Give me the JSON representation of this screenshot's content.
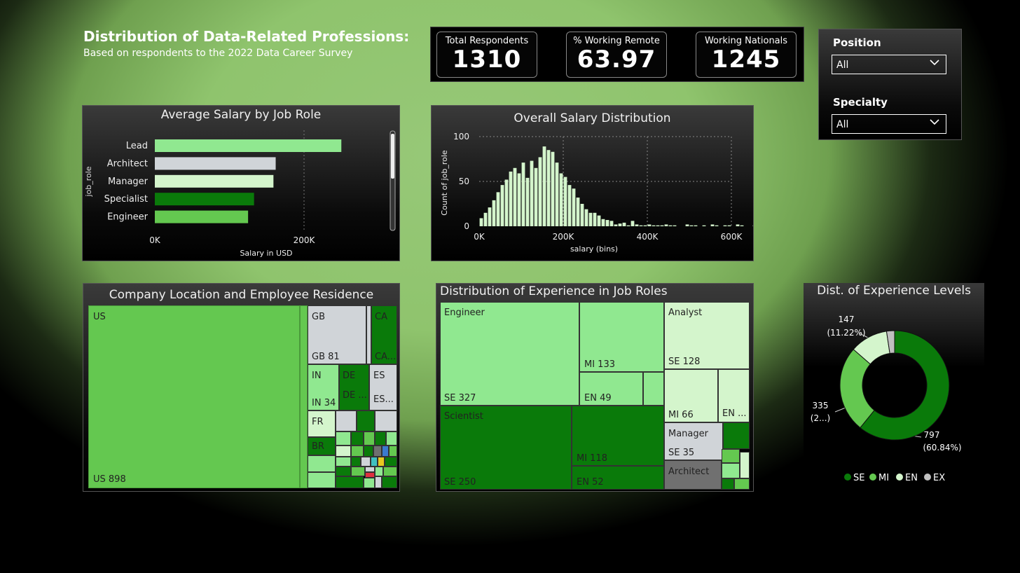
{
  "header": {
    "title": "Distribution of Data-Related Professions:",
    "subtitle": "Based on respondents to the 2022 Data Career Survey"
  },
  "kpis": [
    {
      "label": "Total Respondents",
      "value": "1310"
    },
    {
      "label": "% Working Remote",
      "value": "63.97"
    },
    {
      "label": "Working Nationals",
      "value": "1245"
    }
  ],
  "filters": {
    "position": {
      "label": "Position",
      "selected": "All"
    },
    "specialty": {
      "label": "Specialty",
      "selected": "All"
    }
  },
  "icons": {
    "dropdown": "chevron-down-icon"
  },
  "colors": {
    "light_green": "#90e890",
    "pale": "#d4f5cc",
    "gray": "#d0d4d8",
    "dark_green": "#0a7a0a",
    "mid_green": "#64c850",
    "ex_gray": "#c0c0c0"
  },
  "charts": {
    "salary_by_role": {
      "title": "Average Salary by Job Role",
      "ylabel": "job_role",
      "xlabel": "Salary in USD",
      "xticks": [
        "0K",
        "200K"
      ]
    },
    "salary_distribution": {
      "title": "Overall Salary Distribution",
      "ylabel": "Count of job_role",
      "xlabel": "salary (bins)",
      "xticks": [
        "0K",
        "200K",
        "400K",
        "600K"
      ],
      "yticks": [
        "0",
        "50",
        "100"
      ]
    },
    "location_treemap": {
      "title": "Company Location and Employee Residence",
      "tiles": [
        {
          "name": "US",
          "value_label": "US 898"
        },
        {
          "name": "GB",
          "value_label": "GB 81"
        },
        {
          "name": "CA",
          "value_label": "CA..."
        },
        {
          "name": "IN",
          "value_label": "IN 34"
        },
        {
          "name": "DE",
          "value_label": "DE ..."
        },
        {
          "name": "ES",
          "value_label": "ES..."
        },
        {
          "name": "FR",
          "value_label": ""
        },
        {
          "name": "BR",
          "value_label": ""
        }
      ]
    },
    "experience_treemap": {
      "title": "Distribution of Experience in Job Roles",
      "roles": [
        {
          "name": "Engineer",
          "labels": [
            "SE 327",
            "MI 133",
            "EN 49"
          ]
        },
        {
          "name": "Scientist",
          "labels": [
            "SE 250",
            "MI 118",
            "EN 52"
          ]
        },
        {
          "name": "Analyst",
          "labels": [
            "SE 128",
            "MI 66",
            "EN ..."
          ]
        },
        {
          "name": "Manager",
          "labels": [
            "SE 35"
          ]
        },
        {
          "name": "Architect",
          "labels": []
        }
      ]
    },
    "experience_levels": {
      "title": "Dist. of Experience Levels",
      "labels": {
        "se": [
          "797",
          "(60.84%)"
        ],
        "mi": [
          "335",
          "(2...)"
        ],
        "en": [
          "147",
          "(11.22%)"
        ]
      },
      "legend": [
        "SE",
        "MI",
        "EN",
        "EX"
      ]
    }
  },
  "chart_data": [
    {
      "type": "bar",
      "orientation": "horizontal",
      "title": "Average Salary by Job Role",
      "ylabel": "job_role",
      "xlabel": "Salary in USD",
      "categories": [
        "Lead",
        "Architect",
        "Manager",
        "Specialist",
        "Engineer"
      ],
      "values": [
        250000,
        162000,
        159000,
        133000,
        125000
      ],
      "xlim": [
        0,
        320000
      ],
      "colors": [
        "#90e890",
        "#d0d4d8",
        "#d4f5cc",
        "#0a7a0a",
        "#64c850"
      ]
    },
    {
      "type": "bar",
      "title": "Overall Salary Distribution",
      "xlabel": "salary (bins)",
      "ylabel": "Count of job_role",
      "x_range": [
        0,
        600000
      ],
      "ylim": [
        0,
        100
      ],
      "bin_width": 10000,
      "values": [
        9,
        15,
        21,
        29,
        38,
        46,
        52,
        61,
        65,
        59,
        71,
        54,
        73,
        65,
        77,
        89,
        85,
        83,
        71,
        59,
        55,
        46,
        42,
        32,
        25,
        19,
        15,
        15,
        12,
        8,
        7,
        6,
        2,
        3,
        4,
        1,
        6,
        2,
        1,
        1,
        2,
        1,
        1,
        1,
        2,
        1,
        1,
        0,
        0,
        2,
        1,
        1,
        0,
        1,
        0,
        2,
        1,
        0,
        1,
        1,
        0,
        2,
        1,
        0,
        0,
        1,
        5,
        1,
        1,
        0,
        0,
        0,
        0,
        0,
        1,
        0,
        0,
        0,
        0,
        0,
        1,
        1,
        0,
        0,
        0,
        0,
        0,
        0,
        0,
        0
      ]
    },
    {
      "type": "treemap",
      "title": "Company Location and Employee Residence",
      "data": [
        {
          "name": "US",
          "value": 898
        },
        {
          "name": "GB",
          "value": 81
        },
        {
          "name": "IN",
          "value": 34
        }
      ]
    },
    {
      "type": "treemap",
      "title": "Distribution of Experience in Job Roles",
      "data": [
        {
          "role": "Engineer",
          "SE": 327,
          "MI": 133,
          "EN": 49
        },
        {
          "role": "Scientist",
          "SE": 250,
          "MI": 118,
          "EN": 52
        },
        {
          "role": "Analyst",
          "SE": 128,
          "MI": 66
        },
        {
          "role": "Manager",
          "SE": 35
        }
      ]
    },
    {
      "type": "pie",
      "title": "Dist. of Experience Levels",
      "slices": [
        {
          "name": "SE",
          "value": 797,
          "color": "#0a7a0a"
        },
        {
          "name": "MI",
          "value": 335,
          "color": "#64c850"
        },
        {
          "name": "EN",
          "value": 147,
          "color": "#d4f5cc"
        },
        {
          "name": "EX",
          "value": 31,
          "color": "#c0c0c0"
        }
      ]
    }
  ]
}
